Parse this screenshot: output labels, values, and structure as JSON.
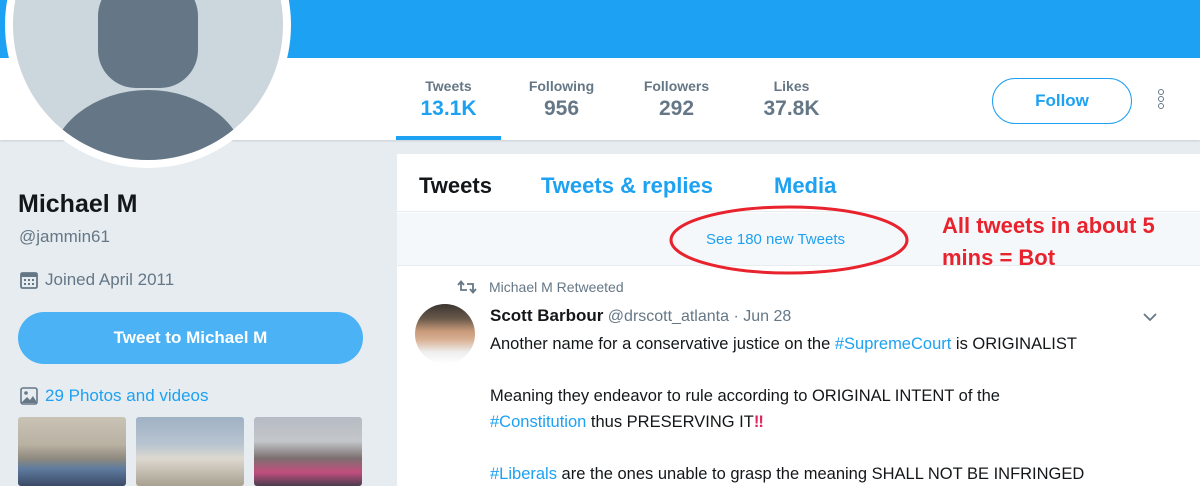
{
  "profile": {
    "name": "Michael M",
    "handle": "@jammin61",
    "joined": "Joined April 2011",
    "tweet_to_label": "Tweet to Michael M",
    "photos_label": "29 Photos and videos"
  },
  "stats": [
    {
      "label": "Tweets",
      "value": "13.1K"
    },
    {
      "label": "Following",
      "value": "956"
    },
    {
      "label": "Followers",
      "value": "292"
    },
    {
      "label": "Likes",
      "value": "37.8K"
    }
  ],
  "header": {
    "follow_label": "Follow"
  },
  "timeline": {
    "tabs": [
      {
        "label": "Tweets"
      },
      {
        "label": "Tweets & replies"
      },
      {
        "label": "Media"
      }
    ],
    "new_tweets": "See 180 new Tweets"
  },
  "tweet": {
    "retweet_context": "Michael M Retweeted",
    "author_name": "Scott Barbour",
    "author_handle": "@drscott_atlanta",
    "separator": "·",
    "date": "Jun 28",
    "line1_pre": "Another name for a conservative justice on the ",
    "line1_tag": "#SupremeCourt",
    "line1_post": " is ORIGINALIST",
    "line2": "Meaning they endeavor to rule according to ORIGINAL INTENT of the",
    "line3_tag": "#Constitution",
    "line3_post": " thus PRESERVING IT",
    "line3_emoji": "‼",
    "line4_tag": "#Liberals",
    "line4_post": " are the ones unable to grasp the meaning SHALL NOT BE INFRINGED"
  },
  "annotation": {
    "line1": "All tweets in about 5",
    "line2": "mins = Bot",
    "color": "#e8232d"
  },
  "colors": {
    "brand": "#1da1f2",
    "muted": "#657786",
    "background": "#e6ecf0"
  },
  "icons": [
    "calendar-icon",
    "photo-icon",
    "retweet-icon",
    "chevron-down-icon",
    "more-vertical-icon"
  ]
}
